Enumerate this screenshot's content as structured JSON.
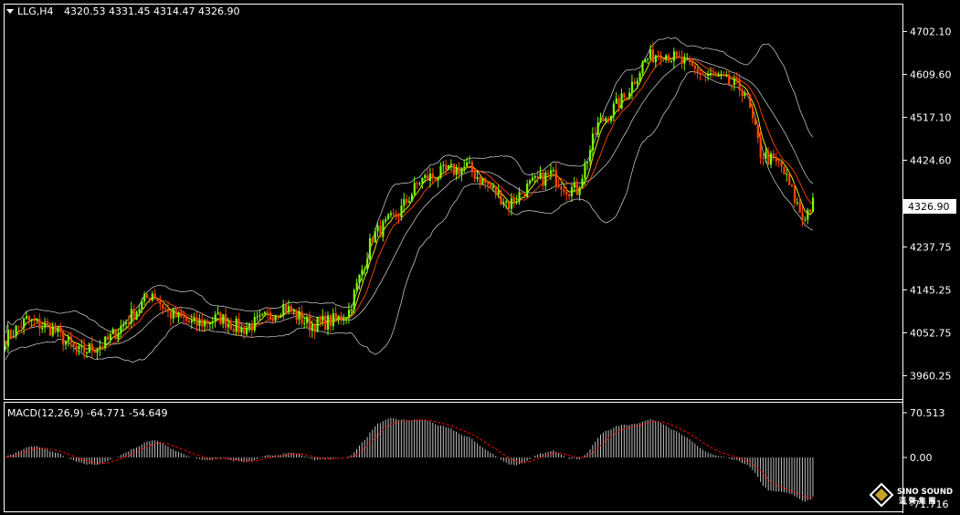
{
  "chart_header": {
    "symbol_label": "LLG,H4",
    "ohlc_text": "4320.53 4331.45 4314.47 4326.90"
  },
  "price_axis": {
    "ticks": [
      "4702.10",
      "4609.60",
      "4517.10",
      "4424.60",
      "4326.90",
      "4237.75",
      "4145.25",
      "4052.75",
      "3960.25"
    ],
    "current_price": "4326.90"
  },
  "macd_panel": {
    "label": "MACD(12,26,9) -64.771 -54.649",
    "ticks": [
      "70.513",
      "0.00",
      "-71.716"
    ]
  },
  "watermark": {
    "brand": "SINO SOUND",
    "sub": "漢 聲 集 團"
  },
  "colors": {
    "bull": "#7CFC00",
    "bear": "#FF4500",
    "bands": "#C0C0C0",
    "ma": "#FFFF00",
    "signal": "#FF0000",
    "macd_hist": "#C0C0C0",
    "frame": "#FFFFFF"
  },
  "chart_data": [
    {
      "type": "candlestick",
      "title": "LLG,H4",
      "ylim": [
        3910,
        4760
      ],
      "y_ticks": [
        4702.1,
        4609.6,
        4517.1,
        4424.6,
        4326.9,
        4237.75,
        4145.25,
        4052.75,
        3960.25
      ],
      "trend_anchors": [
        [
          0,
          4040
        ],
        [
          8,
          4080
        ],
        [
          18,
          4060
        ],
        [
          28,
          4010
        ],
        [
          38,
          4030
        ],
        [
          48,
          4090
        ],
        [
          56,
          4140
        ],
        [
          62,
          4095
        ],
        [
          72,
          4070
        ],
        [
          82,
          4085
        ],
        [
          90,
          4060
        ],
        [
          98,
          4080
        ],
        [
          106,
          4110
        ],
        [
          116,
          4070
        ],
        [
          126,
          4080
        ],
        [
          131,
          4100
        ],
        [
          140,
          4260
        ],
        [
          150,
          4310
        ],
        [
          158,
          4380
        ],
        [
          168,
          4400
        ],
        [
          176,
          4410
        ],
        [
          184,
          4370
        ],
        [
          192,
          4330
        ],
        [
          200,
          4370
        ],
        [
          208,
          4395
        ],
        [
          214,
          4365
        ],
        [
          218,
          4360
        ],
        [
          226,
          4500
        ],
        [
          236,
          4560
        ],
        [
          244,
          4640
        ],
        [
          250,
          4660
        ],
        [
          258,
          4635
        ],
        [
          266,
          4610
        ],
        [
          274,
          4595
        ],
        [
          282,
          4575
        ],
        [
          288,
          4440
        ],
        [
          296,
          4410
        ],
        [
          304,
          4300
        ],
        [
          308,
          4330
        ]
      ],
      "bollinger": {
        "period": 20,
        "deviation": 2,
        "color": "#C0C0C0"
      },
      "moving_averages": [
        {
          "period": 5,
          "color": "#FFFF00"
        },
        {
          "period": 10,
          "color": "#FF4500"
        }
      ]
    },
    {
      "type": "bar",
      "title": "MACD(12,26,9)",
      "series": [
        {
          "name": "MACD",
          "value_last": -64.771
        },
        {
          "name": "Signal",
          "value_last": -54.649
        }
      ],
      "ylim": [
        -71.716,
        70.513
      ],
      "y_ticks": [
        70.513,
        0.0,
        -71.716
      ]
    }
  ]
}
